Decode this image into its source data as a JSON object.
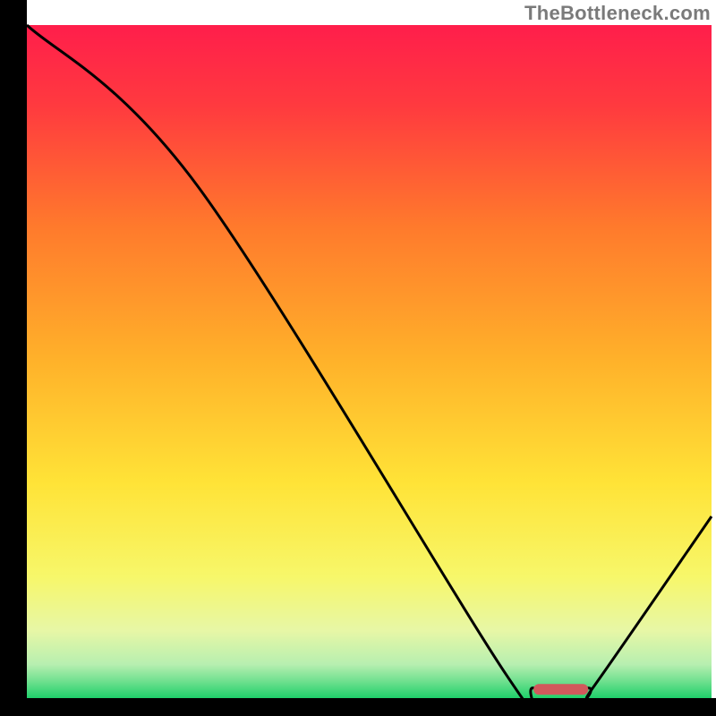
{
  "watermark": "TheBottleneck.com",
  "chart_data": {
    "type": "line",
    "title": "",
    "xlabel": "",
    "ylabel": "",
    "xlim": [
      0,
      100
    ],
    "ylim": [
      0,
      100
    ],
    "grid": false,
    "series": [
      {
        "name": "curve",
        "x": [
          0,
          25,
          70,
          74,
          82,
          83,
          100
        ],
        "values": [
          100,
          76,
          3.5,
          1.5,
          1.5,
          2,
          27
        ]
      }
    ],
    "marker": {
      "x_start": 74,
      "x_end": 82,
      "y": 1.3
    },
    "gradient_stops": [
      {
        "offset": 0.0,
        "color": "#ff1e4b"
      },
      {
        "offset": 0.12,
        "color": "#ff3a3f"
      },
      {
        "offset": 0.3,
        "color": "#ff7a2c"
      },
      {
        "offset": 0.5,
        "color": "#ffb22a"
      },
      {
        "offset": 0.68,
        "color": "#ffe337"
      },
      {
        "offset": 0.82,
        "color": "#f7f76a"
      },
      {
        "offset": 0.9,
        "color": "#e7f7a6"
      },
      {
        "offset": 0.95,
        "color": "#b7efb0"
      },
      {
        "offset": 0.975,
        "color": "#6fe08f"
      },
      {
        "offset": 1.0,
        "color": "#1fd06a"
      }
    ],
    "axis_color": "#000000",
    "curve_color": "#000000",
    "marker_color": "#d1595c"
  }
}
